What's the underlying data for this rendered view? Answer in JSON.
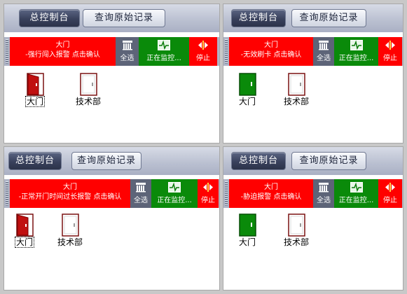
{
  "colors": {
    "alarm_red": "#ff0000",
    "monitor_green": "#0a8a0a",
    "door_red": "#c01010",
    "door_green": "#0a8a0a",
    "door_outline": "#7a1010"
  },
  "panels": [
    {
      "top_buttons": {
        "console": "总控制台",
        "records": "查询原始记录"
      },
      "alarm": {
        "line1": "大门",
        "line2": "-强行闯入报警 点击确认"
      },
      "tools": {
        "select_all": "全选",
        "monitoring": "正在监控...",
        "stop": "停止"
      },
      "doors": [
        {
          "label": "大门",
          "state": "alarm-open",
          "focused": true
        },
        {
          "label": "技术部",
          "state": "closed",
          "focused": false
        }
      ]
    },
    {
      "top_buttons": {
        "console": "总控制台",
        "records": "查询原始记录"
      },
      "alarm": {
        "line1": "大门",
        "line2": "-无效刷卡 点击确认"
      },
      "tools": {
        "select_all": "全选",
        "monitoring": "正在监控...",
        "stop": "停止"
      },
      "doors": [
        {
          "label": "大门",
          "state": "normal",
          "focused": false
        },
        {
          "label": "技术部",
          "state": "closed",
          "focused": false
        }
      ]
    },
    {
      "top_buttons": {
        "console": "总控制台",
        "records": "查询原始记录"
      },
      "alarm": {
        "line1": "大门",
        "line2": "-正常开门时间过长报警 点击确认"
      },
      "tools": {
        "select_all": "全选",
        "monitoring": "正在监控...",
        "stop": "停止"
      },
      "doors": [
        {
          "label": "大门",
          "state": "alarm-open",
          "focused": true
        },
        {
          "label": "技术部",
          "state": "closed",
          "focused": false
        }
      ]
    },
    {
      "top_buttons": {
        "console": "总控制台",
        "records": "查询原始记录"
      },
      "alarm": {
        "line1": "大门",
        "line2": "-胁迫报警 点击确认"
      },
      "tools": {
        "select_all": "全选",
        "monitoring": "正在监控...",
        "stop": "停止"
      },
      "doors": [
        {
          "label": "大门",
          "state": "normal",
          "focused": false
        },
        {
          "label": "技术部",
          "state": "closed",
          "focused": false
        }
      ]
    }
  ]
}
